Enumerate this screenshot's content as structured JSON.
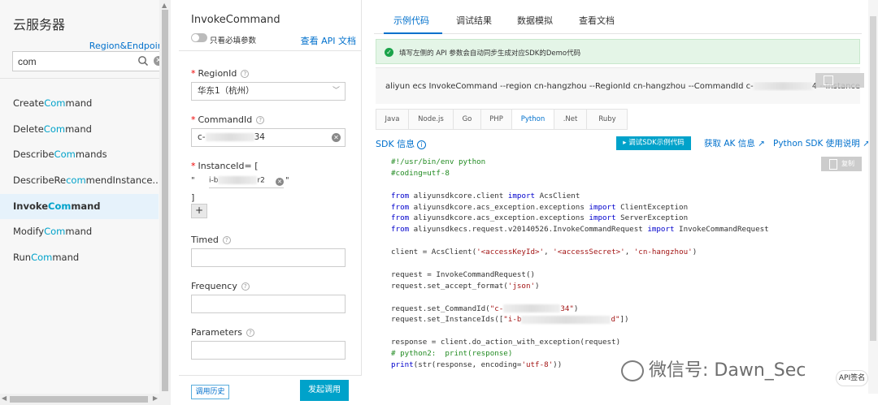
{
  "left": {
    "title": "云服务器",
    "region_link": "Region&Endpoint",
    "search_value": "com",
    "items": [
      {
        "pre": "Create",
        "hl": "Com",
        "post": "mand"
      },
      {
        "pre": "Delete",
        "hl": "Com",
        "post": "mand"
      },
      {
        "pre": "Describe",
        "hl": "Com",
        "post": "mands"
      },
      {
        "pre": "DescribeRe",
        "hl": "com",
        "post": "mendInstance..."
      },
      {
        "pre": "Invoke",
        "hl": "Com",
        "post": "mand"
      },
      {
        "pre": "Modify",
        "hl": "Com",
        "post": "mand"
      },
      {
        "pre": "Run",
        "hl": "Com",
        "post": "mand"
      }
    ],
    "active_index": 4
  },
  "middle": {
    "title": "InvokeCommand",
    "toggle_label": "只看必填参数",
    "doc_link": "查看 API 文档",
    "region_label": "RegionId",
    "region_value": "华东1（杭州）",
    "command_label": "CommandId",
    "command_prefix": "c-",
    "command_suffix": "34",
    "instance_label": "InstanceId= [",
    "instance_quote_open": "\"",
    "instance_prefix": "i-b",
    "instance_suffix": "r2",
    "instance_quote_close": "\"",
    "instance_bracket_close": "]",
    "plus": "+",
    "timed_label": "Timed",
    "frequency_label": "Frequency",
    "parameters_label": "Parameters",
    "history_button": "调用历史",
    "call_button": "发起调用"
  },
  "right": {
    "tabs": [
      "示例代码",
      "调试结果",
      "数据模拟",
      "查看文档"
    ],
    "notice": "填写左侧的 API 参数会自动同步生成对应SDK的Demo代码",
    "cli_pre": "aliyun ecs InvokeCommand --region cn-hangzhou --RegionId cn-hangzhou --CommandId c-",
    "cli_post": "4 --InstanceId.1 i-bp1",
    "langs": [
      "Java",
      "Node.js",
      "Go",
      "PHP",
      "Python",
      ".Net",
      "Ruby"
    ],
    "active_lang": "Python",
    "sdk_info": "SDK 信息",
    "debug_button": "调试SDK示例代码",
    "ak_link": "获取 AK 信息",
    "python_link": "Python SDK 使用说明",
    "copy_label": "复制",
    "code": {
      "l1": "#!/usr/bin/env python",
      "l2": "#coding=utf-8",
      "l4a": "from",
      "l4b": " aliyunsdkcore.client ",
      "l4c": "import",
      "l4d": " AcsClient",
      "l5a": "from",
      "l5b": " aliyunsdkcore.acs_exception.exceptions ",
      "l5c": "import",
      "l5d": " ClientException",
      "l6a": "from",
      "l6b": " aliyunsdkcore.acs_exception.exceptions ",
      "l6c": "import",
      "l6d": " ServerException",
      "l7a": "from",
      "l7b": " aliyunsdkecs.request.v20140526.InvokeCommandRequest ",
      "l7c": "import",
      "l7d": " InvokeCommandRequest",
      "l9a": "client = AcsClient(",
      "l9b": "'<accessKeyId>'",
      "l9c": ", ",
      "l9d": "'<accessSecret>'",
      "l9e": ", ",
      "l9f": "'cn-hangzhou'",
      "l9g": ")",
      "l11": "request = InvokeCommandRequest()",
      "l12a": "request.set_accept_format(",
      "l12b": "'json'",
      "l12c": ")",
      "l14a": "request.set_CommandId(",
      "l14b": "\"c-",
      "l14c": "34\"",
      "l14d": ")",
      "l15a": "request.set_InstanceIds([",
      "l15b": "\"i-b",
      "l15c": "d\"",
      "l15d": "])",
      "l17": "response = client.do_action_with_exception(request)",
      "l18": "# python2:  print(response)",
      "l19a": "print(str(response, encoding=",
      "l19b": "'utf-8'",
      "l19c": "))"
    },
    "api_badge": "API签名",
    "watermark": "微信号: Dawn_Sec"
  }
}
